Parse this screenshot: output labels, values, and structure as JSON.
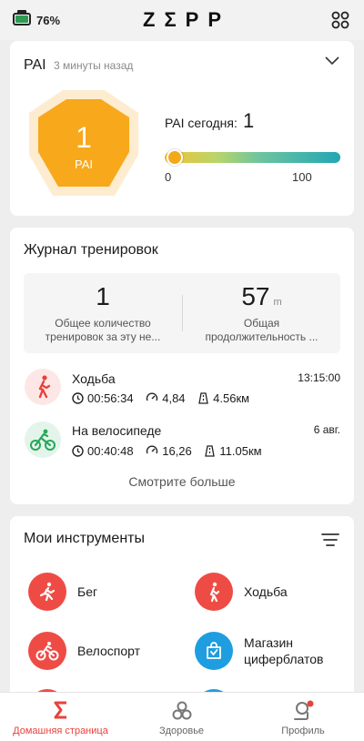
{
  "status": {
    "battery": "76%"
  },
  "header": {
    "logo": "ZΣPP"
  },
  "pai": {
    "title": "PAI",
    "subtitle": "3 минуты назад",
    "value": "1",
    "unit": "PAI",
    "today_label": "PAI сегодня:",
    "today_value": "1",
    "scale_min": "0",
    "scale_max": "100",
    "progress": 0.01,
    "colors": {
      "badge": "#f7a81b",
      "badge_halo": "#fdeccf"
    }
  },
  "workouts": {
    "title": "Журнал тренировок",
    "count_value": "1",
    "count_caption_line1": "Общее количество",
    "count_caption_line2": "тренировок за эту не...",
    "duration_value": "57",
    "duration_unit": "m",
    "duration_caption_line1": "Общая",
    "duration_caption_line2": "продолжительность ...",
    "items": [
      {
        "name": "Ходьба",
        "time": "13:15:00",
        "duration": "00:56:34",
        "pace": "4,84",
        "distance": "4.56км",
        "icon": "walking-icon",
        "color": "#e8423b"
      },
      {
        "name": "На велосипеде",
        "time": "6 авг.",
        "duration": "00:40:48",
        "pace": "16,26",
        "distance": "11.05км",
        "icon": "cycling-icon",
        "color": "#2aa65a"
      }
    ],
    "see_more": "Смотрите больше"
  },
  "tools": {
    "title": "Мои инструменты",
    "items": [
      {
        "label_line1": "Бег",
        "label_line2": "",
        "icon": "running-icon",
        "color": "#ef4b45"
      },
      {
        "label_line1": "Ходьба",
        "label_line2": "",
        "icon": "walking-icon",
        "color": "#ef4b45"
      },
      {
        "label_line1": "Велоспорт",
        "label_line2": "",
        "icon": "cycling-icon",
        "color": "#ef4b45"
      },
      {
        "label_line1": "Магазин",
        "label_line2": "циферблатов",
        "icon": "shopping-bag-icon",
        "color": "#1e9ee0"
      }
    ]
  },
  "nav": {
    "home": "Домашняя страница",
    "health": "Здоровье",
    "profile": "Профиль",
    "active_color": "#e8423b"
  }
}
